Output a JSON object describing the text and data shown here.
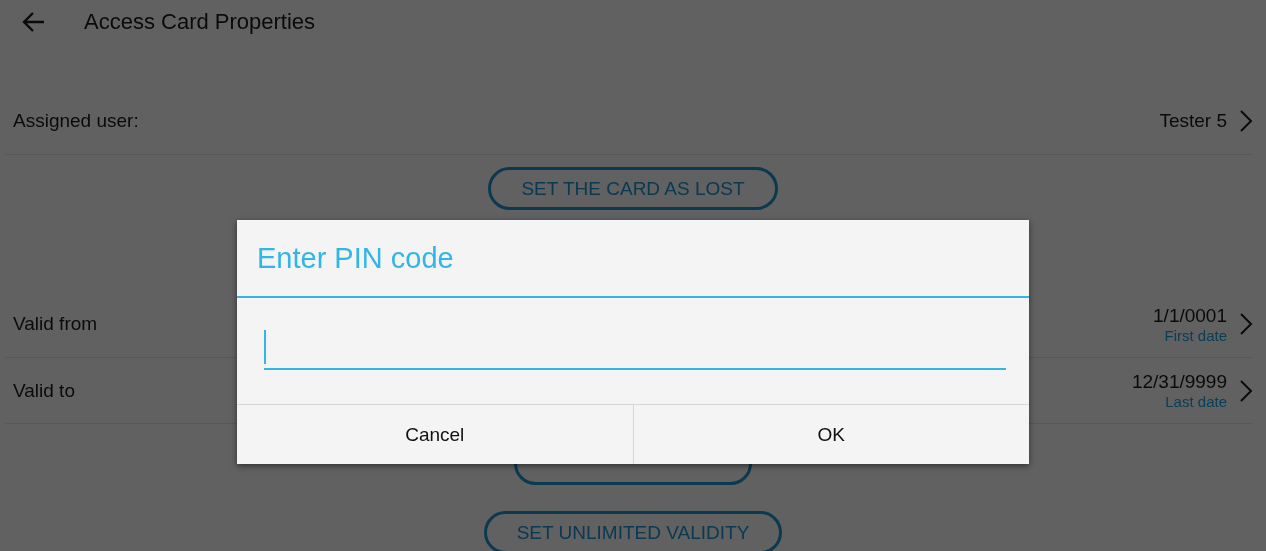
{
  "header": {
    "title": "Access Card Properties"
  },
  "assigned_user": {
    "label": "Assigned user:",
    "value": "Tester 5"
  },
  "lost_button": {
    "label": "SET THE CARD AS LOST"
  },
  "validity": [
    {
      "label": "Valid from",
      "value": "1/1/0001",
      "hint": "First date"
    },
    {
      "label": "Valid to",
      "value": "12/31/9999",
      "hint": "Last date"
    }
  ],
  "unlimited_button": {
    "label": "SET UNLIMITED VALIDITY"
  },
  "dialog": {
    "title": "Enter PIN code",
    "buttons": [
      "Cancel",
      "OK"
    ]
  }
}
